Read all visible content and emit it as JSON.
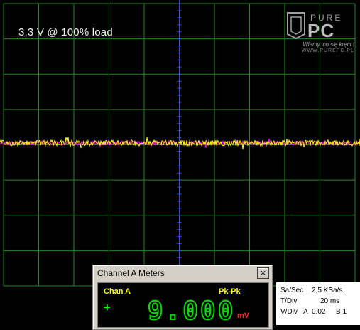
{
  "overlay": {
    "title": "3,3 V @ 100% load"
  },
  "logo": {
    "brand_top": "PURE",
    "brand_main": "PC",
    "tagline": "Wiemy, co się kręci !",
    "site": "WWW.PUREPC.PL"
  },
  "trace": {
    "color_primary": "#ffff00",
    "color_secondary": "#ff00ff",
    "grid_color": "#1f8a1f",
    "axis_color": "#3050ff"
  },
  "meter": {
    "title": "Channel A Meters",
    "close_glyph": "×",
    "channel": "Chan A",
    "mode": "Pk-Pk",
    "sign": "+",
    "reading": "9.000",
    "unit": "mV"
  },
  "settings": {
    "sa_label": "Sa/Sec",
    "sa_value": "2,5 KSa/s",
    "tdiv_label": "T/Div",
    "tdiv_value": "20 ms",
    "vdiv_label": "V/Div",
    "vdiv_channel": "A",
    "vdiv_value": "0,02",
    "vdiv_other": "B 1"
  }
}
